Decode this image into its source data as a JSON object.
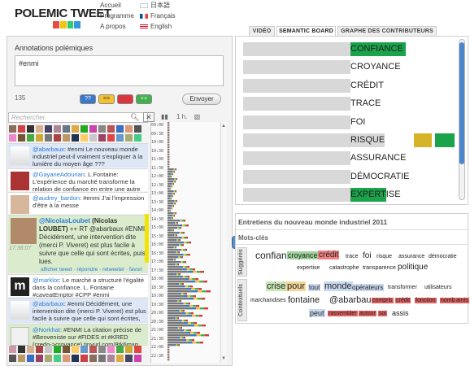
{
  "header": {
    "logo": "POLEMIC TWEET",
    "nav": [
      "Accueil",
      "Programme",
      "A propos"
    ],
    "langs": [
      "日本語",
      "Français",
      "English"
    ]
  },
  "annotations": {
    "title": "Annotations polémiques",
    "text": "#enmi",
    "count": "135",
    "buttons": [
      "??",
      "==",
      "--",
      "++"
    ],
    "send": "Envoyer",
    "search_placeholder": "Rechercher",
    "zoom": "1 h."
  },
  "tweets": [
    {
      "user": "@abarbaux",
      "text": ": #enmi Le nouveau monde industriel peut-il vraiment s'expliquer à la lumière du moyen âge ???"
    },
    {
      "user": "@GayaneAdourian",
      "text": ": L.Fontaine: L'expérience du marché transforme la relation de confiance en entre une autre économie"
    },
    {
      "user": "@audrey_bardon",
      "text": ": #enmi J'ai l'impression d'être à la messe"
    },
    {
      "user": "@NicolasLoubet",
      "name": "(Nicolas LOUBET)",
      "time": "17:38:07",
      "text": "++ RT @abarbaux #ENMI Décidément, une intervention dite (merci P. Viveret) est plus facile à suivre que celle qui sont écrites, puis lues.",
      "actions": "afficher tweet · répondre · retweeter · favori"
    },
    {
      "user": "@marklor",
      "text": ": Le marché a structuré l'égalité dans la confiance. L. Fontaine #caveatEmptor #CPP #enmi"
    },
    {
      "user": "@abarbaux",
      "text": ": #enmi Décidément, une intervention dite (merci P. Viveret) est plus facile à suivre que celle qui sont écrites, puis"
    },
    {
      "user": "@Norkhat",
      "text": ": #ENMI La citation précise de #Benveniste sur #FIDES et #KRED (credo->croyance) tinyurl.com/8tk6mxg"
    }
  ],
  "timeline_labels": [
    "09:00",
    "09:30",
    "10:00",
    "10:30",
    "11:00",
    "11:30",
    "12:00",
    "12:30",
    "13:00",
    "13:30",
    "14:00",
    "14:30",
    "15:00",
    "15:30",
    "16:00",
    "16:30",
    "17:00",
    "17:30",
    "18:00",
    "18:30",
    "19:00",
    "19:30",
    "20:00",
    "20:30",
    "21:00",
    "21:30",
    "22:00",
    "22:30"
  ],
  "tabs": [
    "VIDÉO",
    "SEMANTIC BOARD",
    "GRAPHE DES CONTRIBUTEURS"
  ],
  "semantic_board": [
    {
      "word": "CONFIANCE",
      "fill": 0.75
    },
    {
      "word": "CROYANCE",
      "fill": 0.5
    },
    {
      "word": "CRÉDIT",
      "fill": 0.5
    },
    {
      "word": "TRACE",
      "fill": 0.5
    },
    {
      "word": "FOI",
      "fill": 0.5
    },
    {
      "word": "RISQUE",
      "fill": 0.66
    },
    {
      "word": "ASSURANCE",
      "fill": 0.5
    },
    {
      "word": "DÉMOCRATIE",
      "fill": 0.5
    },
    {
      "word": "EXPERTISE",
      "fill": 0.6
    }
  ],
  "bottom": {
    "title": "Entretiens du nouveau monde industriel 2011",
    "keywords_label": "Mots-clés",
    "suggested_label": "Suggérés",
    "contextual_label": "Contextuels",
    "suggested": [
      "confiance",
      "croyance",
      "crédit",
      "trace",
      "foi",
      "risque",
      "assurance",
      "démocratie",
      "expertise",
      "catastrophe",
      "transparence",
      "politique"
    ],
    "contextual": [
      "crise",
      "pour",
      "tout",
      "monde",
      "opérateurs",
      "transformer",
      "utilisateurs",
      "marchandises",
      "fontaine",
      "@abarbaux",
      "compris",
      "crédit",
      "fonction",
      "nombre",
      "amis",
      "peut",
      "rassembler",
      "autour",
      "soi",
      "assis"
    ]
  },
  "colors": {
    "accent": "#2b7bd6",
    "green": "#1aa34a",
    "yellow": "#f2e400",
    "red": "#e34d4d"
  }
}
